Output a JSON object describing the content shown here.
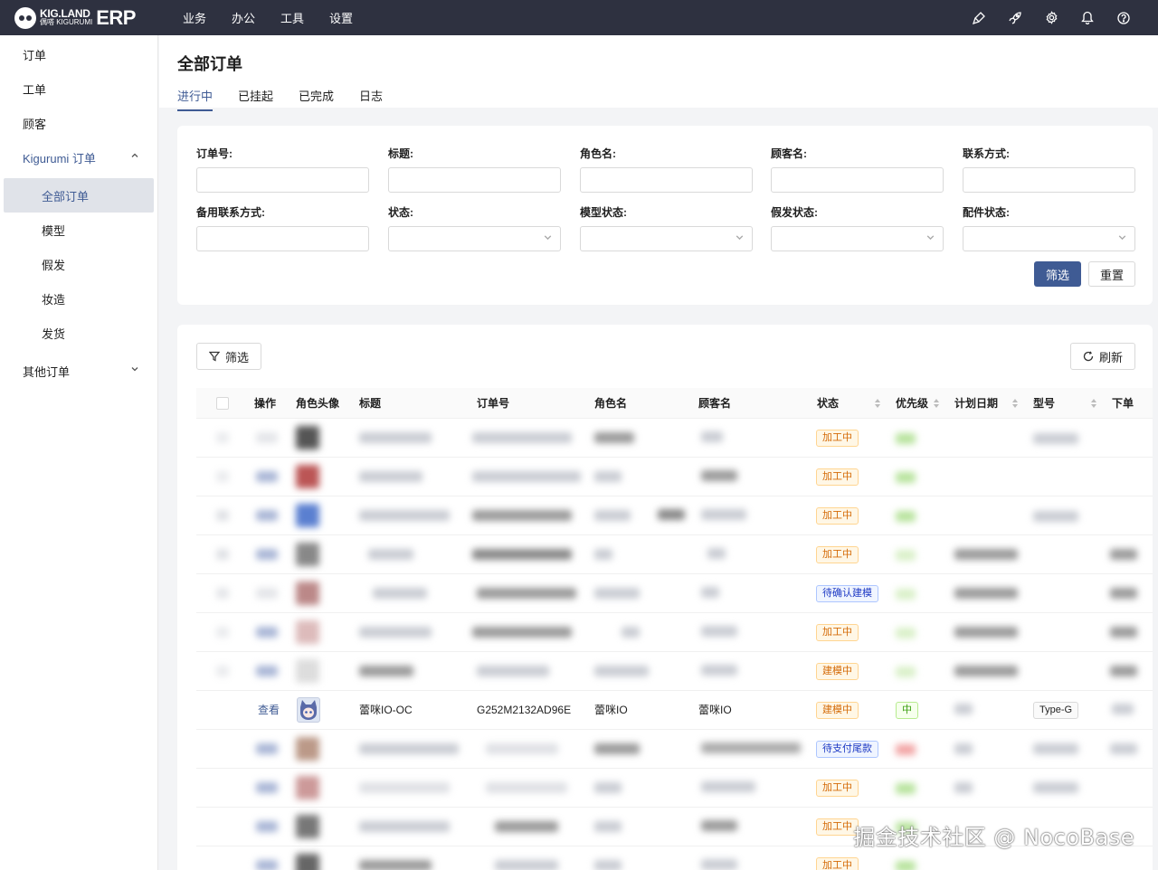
{
  "app": {
    "logo_line1": "KIG.LAND",
    "logo_line2": "偶嗒 KIGURUMI",
    "logo_erp": "ERP",
    "top_menu": [
      "业务",
      "办公",
      "工具",
      "设置"
    ],
    "accent_color": "#3f5b94",
    "top_icons": [
      "brush-icon",
      "rocket-icon",
      "gear-icon",
      "bell-icon",
      "help-icon"
    ]
  },
  "sidebar": {
    "items": [
      {
        "label": "订单"
      },
      {
        "label": "工单"
      },
      {
        "label": "顾客"
      },
      {
        "label": "Kigurumi 订单",
        "expanded": true
      },
      {
        "label": "全部订单",
        "active": true
      },
      {
        "label": "模型"
      },
      {
        "label": "假发"
      },
      {
        "label": "妆造"
      },
      {
        "label": "发货"
      },
      {
        "label": "其他订单",
        "expanded": false
      }
    ]
  },
  "page": {
    "title": "全部订单",
    "tabs": [
      {
        "label": "进行中",
        "active": true
      },
      {
        "label": "已挂起"
      },
      {
        "label": "已完成"
      },
      {
        "label": "日志"
      }
    ]
  },
  "filters": {
    "fields": [
      {
        "label": "订单号:",
        "type": "text",
        "value": ""
      },
      {
        "label": "标题:",
        "type": "text",
        "value": ""
      },
      {
        "label": "角色名:",
        "type": "text",
        "value": ""
      },
      {
        "label": "顾客名:",
        "type": "text",
        "value": ""
      },
      {
        "label": "联系方式:",
        "type": "text",
        "value": ""
      },
      {
        "label": "备用联系方式:",
        "type": "text",
        "value": ""
      },
      {
        "label": "状态:",
        "type": "select",
        "value": ""
      },
      {
        "label": "模型状态:",
        "type": "select",
        "value": ""
      },
      {
        "label": "假发状态:",
        "type": "select",
        "value": ""
      },
      {
        "label": "配件状态:",
        "type": "select",
        "value": ""
      }
    ],
    "submit_label": "筛选",
    "reset_label": "重置"
  },
  "table": {
    "toolbar_filter_label": "筛选",
    "toolbar_refresh_label": "刷新",
    "columns": [
      "操作",
      "角色头像",
      "标题",
      "订单号",
      "角色名",
      "顾客名",
      "状态",
      "优先级",
      "计划日期",
      "型号",
      "下单"
    ],
    "rows": [
      {
        "status": "加工中",
        "status_color": "orange"
      },
      {
        "status": "加工中",
        "status_color": "orange"
      },
      {
        "status": "加工中",
        "status_color": "orange"
      },
      {
        "status": "加工中",
        "status_color": "orange"
      },
      {
        "status": "待确认建模",
        "status_color": "blue"
      },
      {
        "status": "加工中",
        "status_color": "orange"
      },
      {
        "status": "建模中",
        "status_color": "orange"
      },
      {
        "action": "查看",
        "title": "蕾咪IO-OC",
        "order_no": "G252M2132AD96E",
        "role": "蕾咪IO",
        "customer": "蕾咪IO",
        "status": "建模中",
        "status_color": "orange",
        "priority": "中",
        "model": "Type-G",
        "clear": true
      },
      {
        "status": "待支付尾款",
        "status_color": "blue"
      },
      {
        "status": "加工中",
        "status_color": "orange"
      },
      {
        "status": "加工中",
        "status_color": "orange"
      },
      {
        "status": "加工中",
        "status_color": "orange"
      }
    ]
  },
  "watermark": "掘金技术社区 @ NocoBase"
}
